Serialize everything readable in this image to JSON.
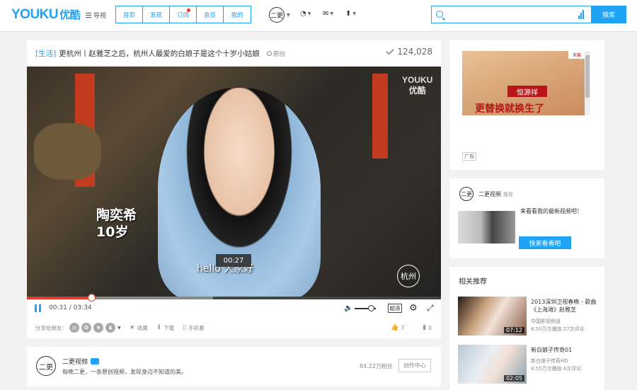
{
  "header": {
    "logo_text": "YOUKU",
    "logo_cn": "优酷",
    "menu_label": "导视",
    "tabs": [
      {
        "label": "首页",
        "dot": false
      },
      {
        "label": "发现",
        "dot": false
      },
      {
        "label": "订阅",
        "dot": true
      },
      {
        "label": "会员",
        "dot": false
      },
      {
        "label": "我的",
        "dot": false
      }
    ],
    "search_placeholder": "",
    "search_button": "搜库"
  },
  "video": {
    "category": "[生活]",
    "title": "更杭州丨赵雅芝之后，杭州人最爱的白娘子是这个十岁小姑娘",
    "original_label": "原创",
    "views": "124,028",
    "watermark_en": "YOUKU",
    "watermark_cn": "优酷",
    "overlay_name": "陶奕希",
    "overlay_age": "10岁",
    "subtitle": "hello 大家好",
    "hover_time": "00:27",
    "corner_logo": "杭州",
    "current_time": "00:31",
    "duration": "03:34",
    "progress": 0.155,
    "buffered": 0.45,
    "volume": 0.75,
    "quality": "超清",
    "share_label": "分享给朋友：",
    "actions": [
      {
        "label": "收藏"
      },
      {
        "label": "下载"
      },
      {
        "label": "手机看"
      }
    ],
    "likes": "7",
    "dislikes": "0"
  },
  "author": {
    "name": "二更视频",
    "avatar_text": "二更",
    "description": "每晚二更，一条原创视频，发现身边不知道的美。",
    "fans": "84.22万粉丝",
    "create_center": "创作中心"
  },
  "ad": {
    "tmall": "天猫",
    "brand": "恒源祥",
    "slogan": "更替换就换生了",
    "label": "广告"
  },
  "recommend": {
    "name": "二更视频",
    "tag": "推荐",
    "text": "来看看我的最新视频吧！",
    "button": "快来看看吧"
  },
  "related": {
    "heading": "相关推荐",
    "items": [
      {
        "title": "2013深圳卫视春晚 - 歌曲《上海滩》赵雅芝",
        "source": "中国影视频道",
        "stats": "8.50万次播放 27次评论",
        "duration": "07:12"
      },
      {
        "title": "新白娘子传奇01",
        "source": "新白娘子传奇HD",
        "stats": "8.55万次播放 4次评论",
        "duration": "02:05"
      }
    ]
  }
}
